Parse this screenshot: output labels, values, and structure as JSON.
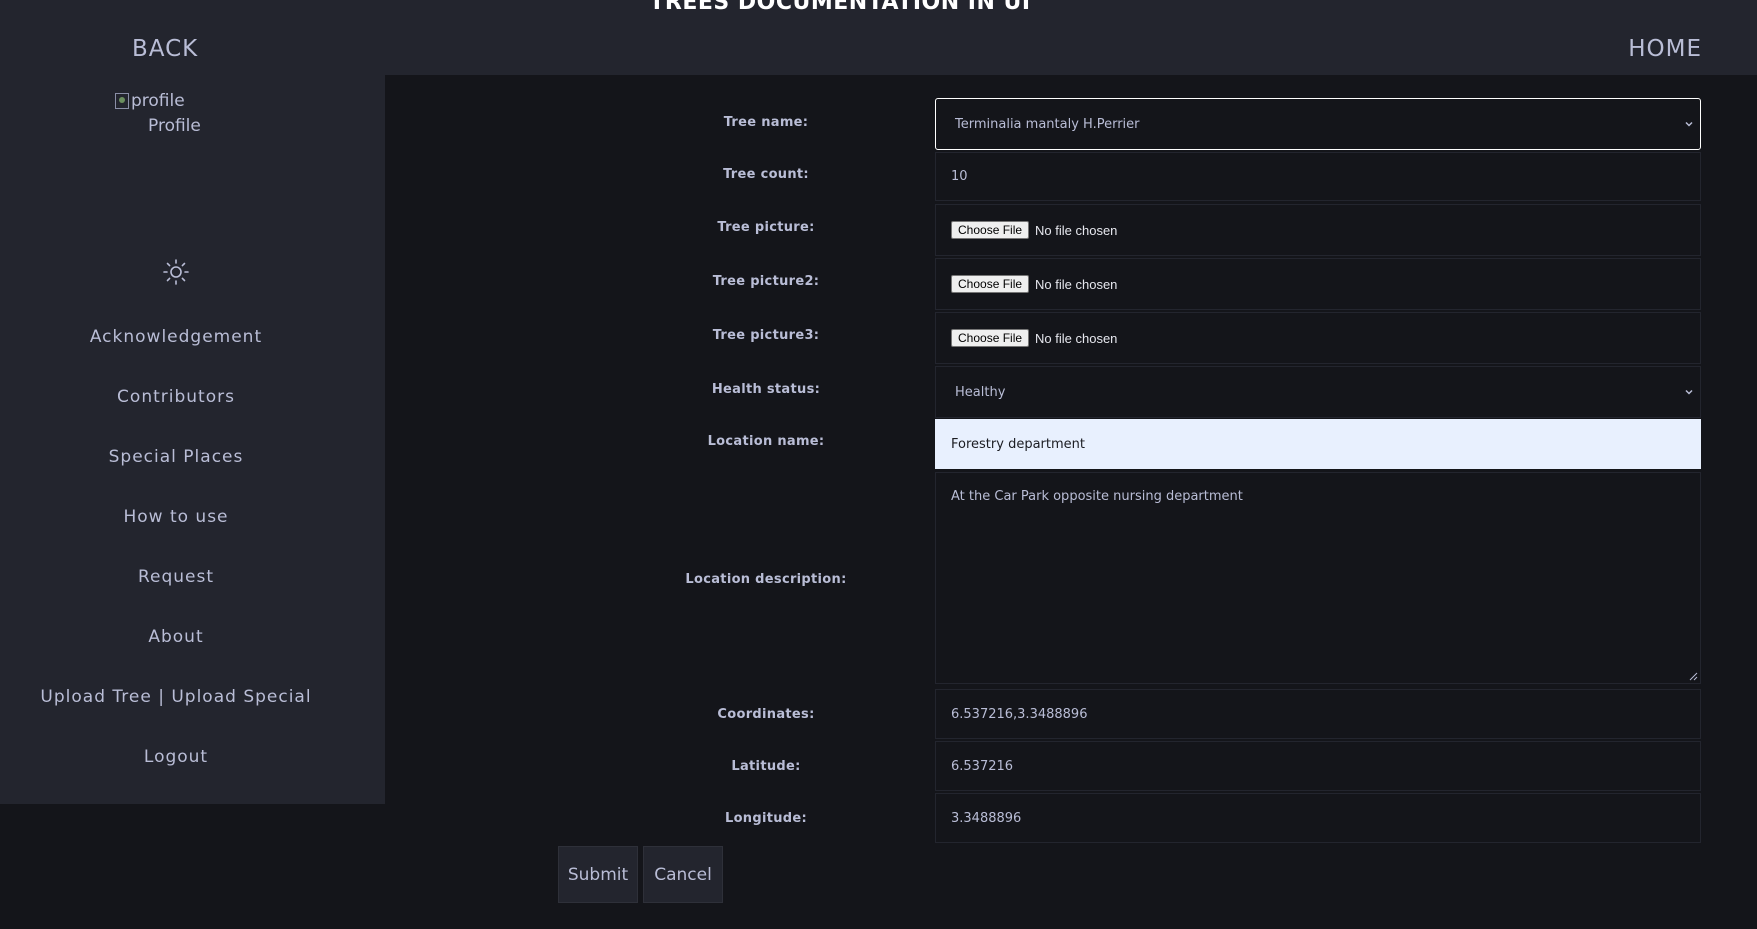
{
  "header": {
    "title": "TREES DOCUMENTATION IN UI",
    "back_label": "BACK",
    "home_label": "HOME"
  },
  "sidebar": {
    "profile_alt": "profile",
    "profile_label": "Profile",
    "theme_icon": "sun-icon",
    "items": [
      {
        "label": "Acknowledgement"
      },
      {
        "label": "Contributors"
      },
      {
        "label": "Special Places"
      },
      {
        "label": "How to use"
      },
      {
        "label": "Request"
      },
      {
        "label": "About"
      },
      {
        "label": "Upload Tree  | Upload Special"
      },
      {
        "label": "Logout"
      }
    ]
  },
  "form": {
    "tree_name": {
      "label": "Tree name:",
      "value": "Terminalia mantaly H.Perrier"
    },
    "tree_count": {
      "label": "Tree count:",
      "value": "10"
    },
    "tree_picture": {
      "label": "Tree picture:",
      "button": "Choose File",
      "status": "No file chosen"
    },
    "tree_picture2": {
      "label": "Tree picture2:",
      "button": "Choose File",
      "status": "No file chosen"
    },
    "tree_picture3": {
      "label": "Tree picture3:",
      "button": "Choose File",
      "status": "No file chosen"
    },
    "health_status": {
      "label": "Health status:",
      "value": "Healthy"
    },
    "location_name": {
      "label": "Location name:",
      "value": "Forestry department"
    },
    "location_description": {
      "label": "Location description:",
      "value": "At the Car Park opposite nursing department"
    },
    "coordinates": {
      "label": "Coordinates:",
      "value": "6.537216,3.3488896"
    },
    "latitude": {
      "label": "Latitude:",
      "value": "6.537216"
    },
    "longitude": {
      "label": "Longitude:",
      "value": "3.3488896"
    },
    "submit_label": "Submit",
    "cancel_label": "Cancel"
  },
  "colors": {
    "background": "#14151a",
    "panel": "#23252e",
    "text": "#b9bdd6",
    "autofill": "#e8f0fe"
  }
}
